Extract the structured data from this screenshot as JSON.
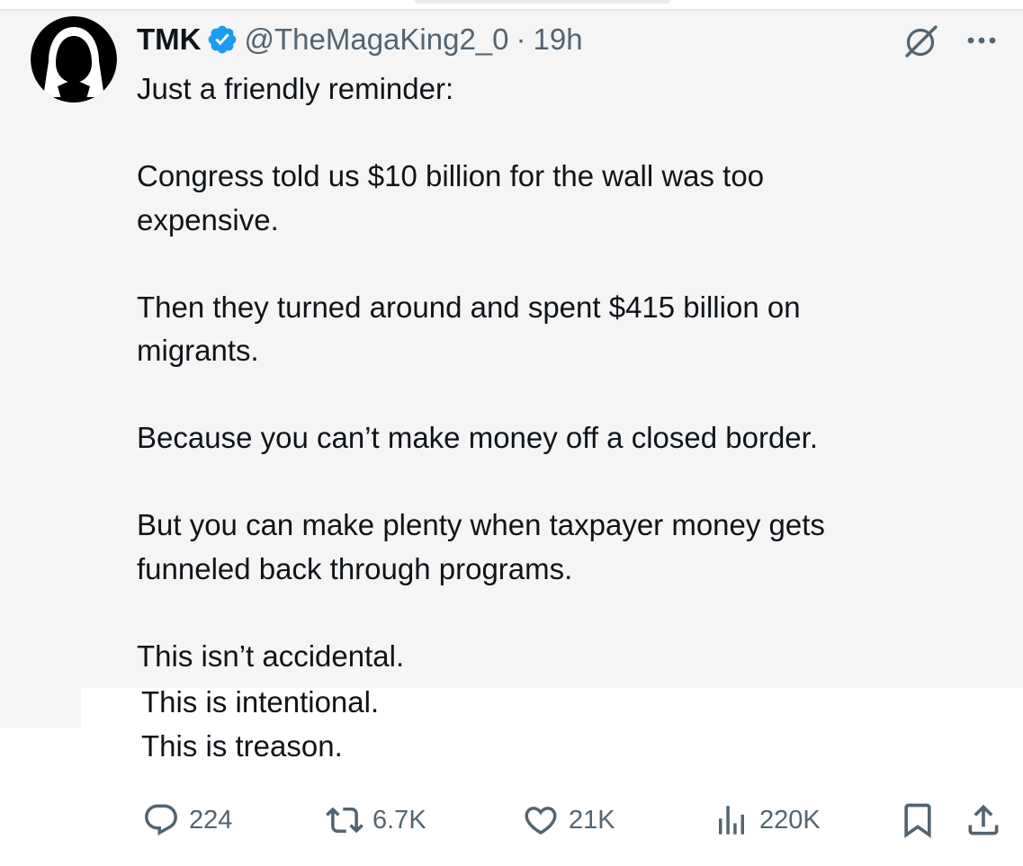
{
  "tweet": {
    "author_name": "TMK",
    "verified": true,
    "handle": "@TheMagaKing2_0",
    "separator": "·",
    "time": "19h",
    "paragraphs": [
      [
        "Just a friendly reminder:"
      ],
      [
        "Congress told us $10 billion for the wall was too",
        "expensive."
      ],
      [
        "Then they turned around and spent $415 billion on",
        "migrants."
      ],
      [
        "Because you can’t make money off a closed border."
      ],
      [
        "But you can make plenty when taxpayer money gets",
        "funneled back through programs."
      ],
      [
        "This isn’t accidental."
      ]
    ],
    "lower_lines": [
      "This is intentional.",
      "This is treason."
    ]
  },
  "icons": {
    "grok": "grok-icon",
    "more": "more-icon",
    "reply": "reply-icon",
    "repost": "repost-icon",
    "like": "heart-icon",
    "views": "views-icon",
    "bookmark": "bookmark-icon",
    "share": "share-icon"
  },
  "actions": {
    "replies": "224",
    "reposts": "6.7K",
    "likes": "21K",
    "views": "220K"
  },
  "colors": {
    "verified_blue": "#1d9bf0",
    "muted": "#536471",
    "text": "#0f1419",
    "tweet_background": "#f5f5f5"
  }
}
